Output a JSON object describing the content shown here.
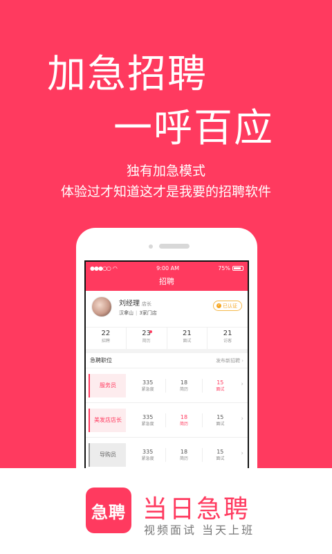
{
  "hero": {
    "headline_line1": "加急招聘",
    "headline_line2": "一呼百应",
    "subtitle_line1": "独有加急模式",
    "subtitle_line2": "体验过才知道这才是我要的招聘软件"
  },
  "status_bar": {
    "signal": "●●●○○",
    "time": "9:00 AM",
    "battery": "75%"
  },
  "nav": {
    "title": "招聘"
  },
  "profile": {
    "name": "刘经理",
    "role": "店长",
    "location": "汉拿山",
    "stores": "3家门店",
    "verified_label": "已认证"
  },
  "stats": [
    {
      "value": "22",
      "label": "招聘"
    },
    {
      "value": "23",
      "label": "简历"
    },
    {
      "value": "21",
      "label": "面试"
    },
    {
      "value": "21",
      "label": "访客"
    }
  ],
  "section": {
    "title": "急聘职位",
    "link": "发布新招聘"
  },
  "jobs": [
    {
      "title": "服务员",
      "urgency_value": "335",
      "urgency_label": "紧急度",
      "resume_value": "18",
      "resume_label": "简历",
      "interview_value": "15",
      "interview_label": "面试"
    },
    {
      "title": "美发店店长",
      "urgency_value": "335",
      "urgency_label": "紧急度",
      "resume_value": "18",
      "resume_label": "简历",
      "interview_value": "15",
      "interview_label": "面试"
    },
    {
      "title": "导购员",
      "urgency_value": "335",
      "urgency_label": "紧急度",
      "resume_value": "18",
      "resume_label": "简历",
      "interview_value": "15",
      "interview_label": "面试"
    }
  ],
  "footer": {
    "logo_text": "急聘",
    "brand": "当日急聘",
    "slogan": "视频面试 当天上班"
  },
  "colors": {
    "brand_red": "#ff3a5f",
    "verify_orange": "#f5a623"
  }
}
